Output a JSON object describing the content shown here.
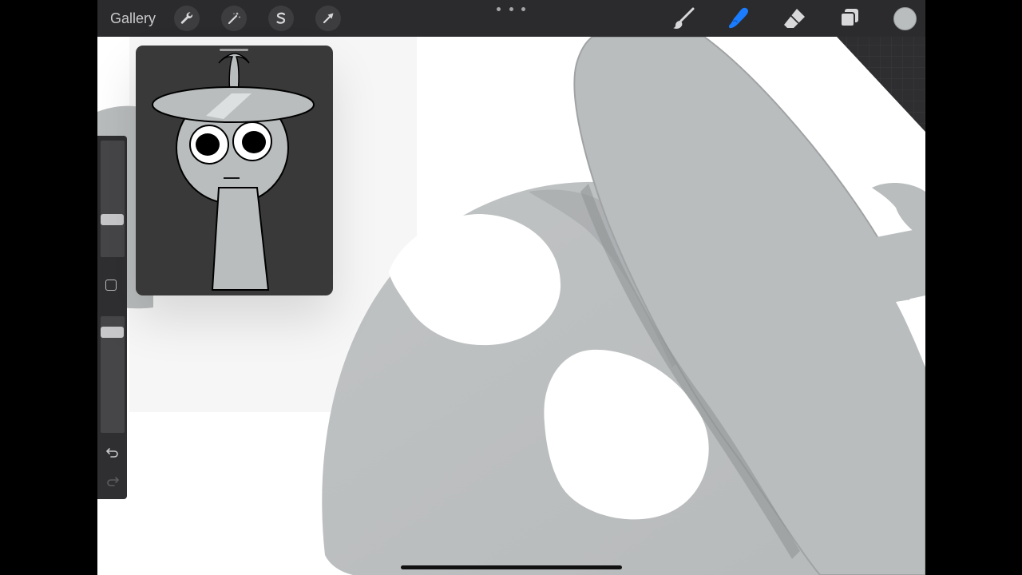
{
  "app": {
    "gallery_label": "Gallery",
    "accent_color": "#1a7cff",
    "current_color": "#b9bdbe"
  },
  "topbar": {
    "left_tools": [
      {
        "name": "actions",
        "icon": "wrench-icon"
      },
      {
        "name": "adjustments",
        "icon": "magic-wand-icon"
      },
      {
        "name": "selection",
        "icon": "selection-s-icon"
      },
      {
        "name": "transform",
        "icon": "arrow-cursor-icon"
      }
    ],
    "right_tools": [
      {
        "name": "brush",
        "icon": "brush-icon",
        "active": false
      },
      {
        "name": "smudge",
        "icon": "smudge-finger-icon",
        "active": true
      },
      {
        "name": "eraser",
        "icon": "eraser-icon",
        "active": false
      },
      {
        "name": "layers",
        "icon": "layers-icon",
        "active": false
      }
    ]
  },
  "sidebar": {
    "brush_size_level": 0.3,
    "opacity_level": 0.9,
    "modify_icon": "square-icon",
    "undo_icon": "undo-arrow-icon",
    "redo_icon": "redo-arrow-icon",
    "redo_enabled": false
  },
  "reference": {
    "icon": "character-thumbnail-image"
  }
}
